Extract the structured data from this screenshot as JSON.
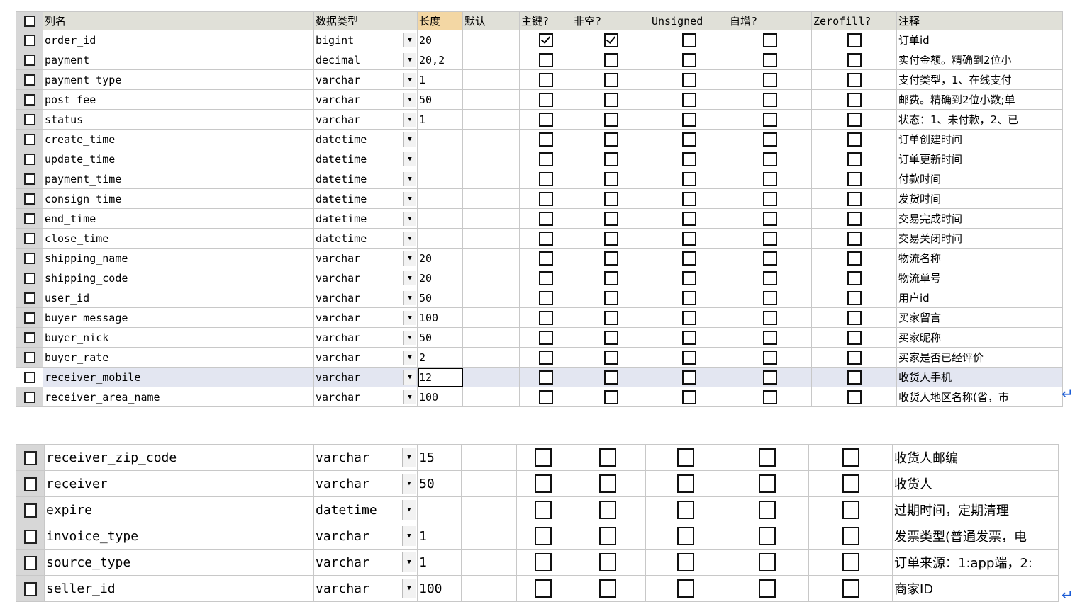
{
  "headers": {
    "name": "列名",
    "type": "数据类型",
    "length": "长度",
    "default": "默认",
    "primary_key": "主键?",
    "not_null": "非空?",
    "unsigned": "Unsigned",
    "auto_increment": "自增?",
    "zerofill": "Zerofill?",
    "comment": "注释"
  },
  "table1_rows": [
    {
      "name": "order_id",
      "type": "bigint",
      "length": "20",
      "pk": true,
      "nn": true,
      "comment": "订单id"
    },
    {
      "name": "payment",
      "type": "decimal",
      "length": "20,2",
      "pk": false,
      "nn": false,
      "comment": "实付金额。精确到2位小"
    },
    {
      "name": "payment_type",
      "type": "varchar",
      "length": "1",
      "pk": false,
      "nn": false,
      "comment": "支付类型，1、在线支付"
    },
    {
      "name": "post_fee",
      "type": "varchar",
      "length": "50",
      "pk": false,
      "nn": false,
      "comment": "邮费。精确到2位小数;单"
    },
    {
      "name": "status",
      "type": "varchar",
      "length": "1",
      "pk": false,
      "nn": false,
      "comment": "状态：1、未付款，2、已"
    },
    {
      "name": "create_time",
      "type": "datetime",
      "length": "",
      "pk": false,
      "nn": false,
      "comment": "订单创建时间"
    },
    {
      "name": "update_time",
      "type": "datetime",
      "length": "",
      "pk": false,
      "nn": false,
      "comment": "订单更新时间"
    },
    {
      "name": "payment_time",
      "type": "datetime",
      "length": "",
      "pk": false,
      "nn": false,
      "comment": "付款时间"
    },
    {
      "name": "consign_time",
      "type": "datetime",
      "length": "",
      "pk": false,
      "nn": false,
      "comment": "发货时间"
    },
    {
      "name": "end_time",
      "type": "datetime",
      "length": "",
      "pk": false,
      "nn": false,
      "comment": "交易完成时间"
    },
    {
      "name": "close_time",
      "type": "datetime",
      "length": "",
      "pk": false,
      "nn": false,
      "comment": "交易关闭时间"
    },
    {
      "name": "shipping_name",
      "type": "varchar",
      "length": "20",
      "pk": false,
      "nn": false,
      "comment": "物流名称"
    },
    {
      "name": "shipping_code",
      "type": "varchar",
      "length": "20",
      "pk": false,
      "nn": false,
      "comment": "物流单号"
    },
    {
      "name": "user_id",
      "type": "varchar",
      "length": "50",
      "pk": false,
      "nn": false,
      "comment": "用户id"
    },
    {
      "name": "buyer_message",
      "type": "varchar",
      "length": "100",
      "pk": false,
      "nn": false,
      "comment": "买家留言"
    },
    {
      "name": "buyer_nick",
      "type": "varchar",
      "length": "50",
      "pk": false,
      "nn": false,
      "comment": "买家昵称"
    },
    {
      "name": "buyer_rate",
      "type": "varchar",
      "length": "2",
      "pk": false,
      "nn": false,
      "comment": "买家是否已经评价"
    },
    {
      "name": "receiver_mobile",
      "type": "varchar",
      "length": "12",
      "pk": false,
      "nn": false,
      "comment": "收货人手机",
      "selected": true
    },
    {
      "name": "receiver_area_name",
      "type": "varchar",
      "length": "100",
      "pk": false,
      "nn": false,
      "comment": "收货人地区名称(省，市"
    }
  ],
  "table2_rows": [
    {
      "name": "receiver_zip_code",
      "type": "varchar",
      "length": "15",
      "pk": false,
      "nn": false,
      "comment": "收货人邮编"
    },
    {
      "name": "receiver",
      "type": "varchar",
      "length": "50",
      "pk": false,
      "nn": false,
      "comment": "收货人"
    },
    {
      "name": "expire",
      "type": "datetime",
      "length": "",
      "pk": false,
      "nn": false,
      "comment": "过期时间，定期清理"
    },
    {
      "name": "invoice_type",
      "type": "varchar",
      "length": "1",
      "pk": false,
      "nn": false,
      "comment": "发票类型(普通发票，电"
    },
    {
      "name": "source_type",
      "type": "varchar",
      "length": "1",
      "pk": false,
      "nn": false,
      "comment": "订单来源：1:app端，2:"
    },
    {
      "name": "seller_id",
      "type": "varchar",
      "length": "100",
      "pk": false,
      "nn": false,
      "comment": "商家ID"
    }
  ],
  "icons": {
    "dropdown": "dropdown-arrow-icon",
    "paragraph_mark": "paragraph-mark-icon",
    "row_selector": "row-selector-icon"
  },
  "colors": {
    "header_bg": "#e0e0d8",
    "selected_row_bg": "#e3e6f1",
    "pilcrow": "#1c5cd6"
  }
}
